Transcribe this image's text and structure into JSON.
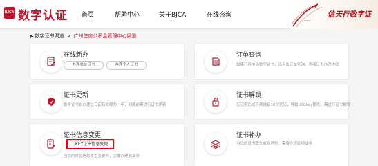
{
  "header": {
    "logo_badge": "BJCA",
    "logo_text": "数字认证",
    "nav": [
      "首页",
      "帮助中心",
      "关于BJCA",
      "在线咨询"
    ],
    "slogan": "信天行数字证",
    "accent_color": "#c0142a"
  },
  "breadcrumb": {
    "root": "数字证书渠道",
    "current": "广州住房公积金管理中心渠道"
  },
  "cards": [
    {
      "title": "在线新办",
      "icon": "document-edit-icon",
      "buttons": [
        "办理单位证书",
        "办理个人证书"
      ]
    },
    {
      "title": "订单查询",
      "icon": "order-query-icon",
      "desc": "如果已经申请数字证书，请点击订单查询，查阅证书办理进度"
    },
    {
      "title": "证书更新",
      "icon": "shield-refresh-icon",
      "desc": "数字证书自办理之日起有效期为一年，到期前需进行证书更新"
    },
    {
      "title": "证书解锁",
      "icon": "unlock-icon",
      "desc": "忘记密码或连续输错10次密码，导致USBkey锁死，需进行证书解锁"
    },
    {
      "title": "证书信息变更",
      "icon": "info-edit-icon",
      "desc_partial": "当您的单位信息发生变更时，需要办理此业务",
      "highlight_label": "UKEY证书信息变更"
    },
    {
      "title": "证书补办",
      "icon": "layers-icon",
      "desc": "当您的证书丢失或损坏时，需要办理此项业务"
    }
  ]
}
